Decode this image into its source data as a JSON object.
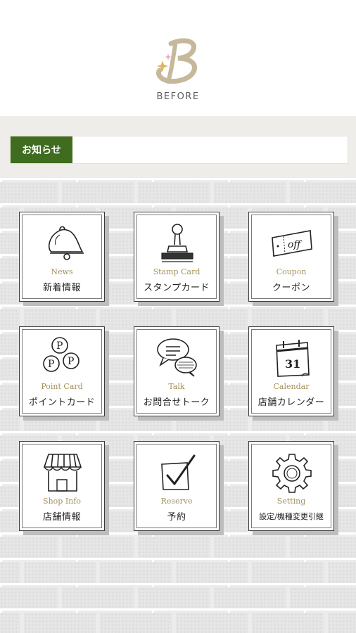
{
  "brand": {
    "name": "BEFORE",
    "accent_color": "#3f6c1f",
    "logo_color": "#c6b89a",
    "sparkle_pink": "#e9a2c6",
    "sparkle_gold": "#e2b45a"
  },
  "news": {
    "label": "お知らせ",
    "content": ""
  },
  "menu": [
    {
      "en": "News",
      "jp": "新着情報",
      "icon": "bell-icon"
    },
    {
      "en": "Stamp Card",
      "jp": "スタンプカード",
      "icon": "stamp-icon"
    },
    {
      "en": "Coupon",
      "jp": "クーポン",
      "icon": "coupon-icon"
    },
    {
      "en": "Point Card",
      "jp": "ポイントカード",
      "icon": "point-coins-icon"
    },
    {
      "en": "Talk",
      "jp": "お問合せトーク",
      "icon": "chat-bubbles-icon"
    },
    {
      "en": "Calendar",
      "jp": "店舗カレンダー",
      "icon": "calendar-icon"
    },
    {
      "en": "Shop Info",
      "jp": "店舗情報",
      "icon": "shop-icon"
    },
    {
      "en": "Reserve",
      "jp": "予約",
      "icon": "checkbox-icon"
    },
    {
      "en": "Setting",
      "jp": "設定/機種変更引継",
      "icon": "gear-icon"
    }
  ],
  "calendar_day": "31",
  "coupon_text": "off",
  "coin_letter": "P"
}
